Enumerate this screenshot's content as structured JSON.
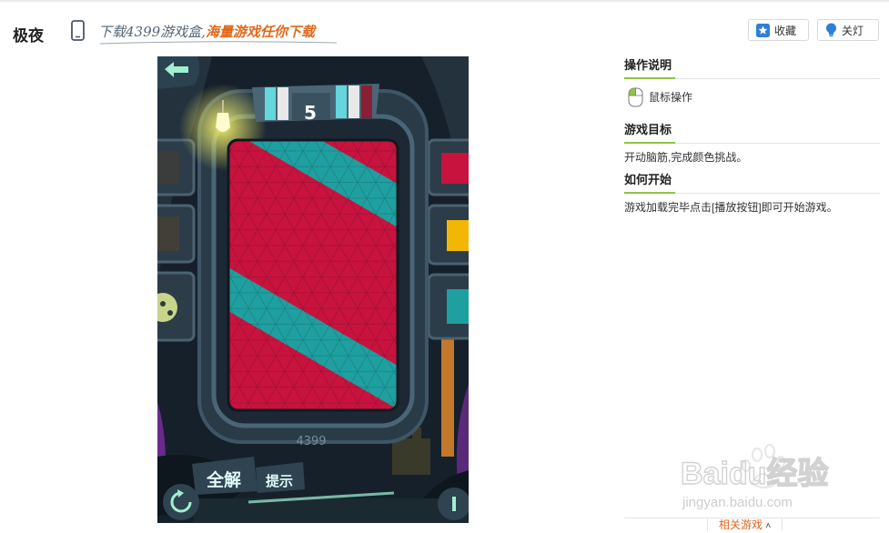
{
  "header": {
    "game_title": "极夜",
    "promo_download": "下载4399游戏盒,",
    "promo_tagline": "海量游戏任你下载",
    "favorite_label": "收藏",
    "lights_off_label": "关灯"
  },
  "game": {
    "level_number": "5",
    "brand_text": "4399",
    "solve_all_label": "全解",
    "hint_label": "提示",
    "colors": {
      "red": "#c8133f",
      "teal": "#1f9fa0",
      "yellow": "#f2b705",
      "frame": "#1d2a35"
    }
  },
  "sidebar": {
    "controls_heading": "操作说明",
    "controls_item": "鼠标操作",
    "goal_heading": "游戏目标",
    "goal_text": "开动脑筋,完成颜色挑战。",
    "start_heading": "如何开始",
    "start_text": "游戏加载完毕点击[播放按钮]即可开始游戏。",
    "accent_color": "#8cc63f"
  },
  "footer": {
    "related_label": "相关游戏",
    "watermark_text": "Baidu经验",
    "watermark_url": "jingyan.baidu.com"
  }
}
